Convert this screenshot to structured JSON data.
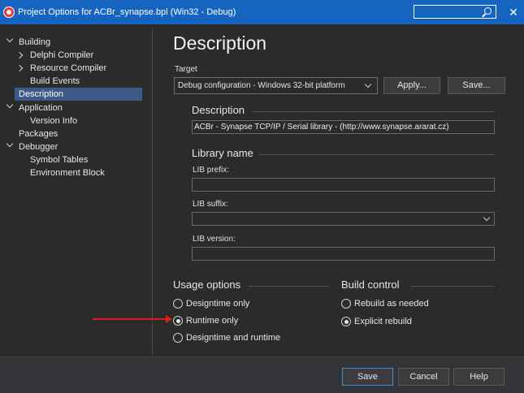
{
  "window": {
    "title": "Project Options for ACBr_synapse.bpl  (Win32 - Debug)",
    "close": "✕"
  },
  "tree": [
    {
      "label": "Building"
    },
    {
      "label": "Delphi Compiler"
    },
    {
      "label": "Resource Compiler"
    },
    {
      "label": "Build Events"
    },
    {
      "label": "Description"
    },
    {
      "label": "Application"
    },
    {
      "label": "Version Info"
    },
    {
      "label": "Packages"
    },
    {
      "label": "Debugger"
    },
    {
      "label": "Symbol Tables"
    },
    {
      "label": "Environment Block"
    }
  ],
  "main": {
    "title": "Description",
    "target_label": "Target",
    "target_value": "Debug configuration - Windows 32-bit platform",
    "apply_label": "Apply...",
    "save_dots_label": "Save...",
    "description_group": "Description",
    "description_value": "ACBr - Synapse TCP/IP / Serial library - (http://www.synapse.ararat.cz)",
    "library_group": "Library name",
    "lib_prefix_label": "LIB prefix:",
    "lib_prefix_value": "",
    "lib_suffix_label": "LIB suffix:",
    "lib_suffix_value": "",
    "lib_version_label": "LIB version:",
    "lib_version_value": "",
    "usage_group": "Usage options",
    "usage_options": [
      "Designtime only",
      "Runtime only",
      "Designtime and runtime"
    ],
    "usage_selected": "Runtime only",
    "build_group": "Build control",
    "build_options": [
      "Rebuild as needed",
      "Explicit rebuild"
    ],
    "build_selected": "Explicit rebuild"
  },
  "footer": {
    "save_label": "Save",
    "cancel_label": "Cancel",
    "help_label": "Help"
  },
  "colors": {
    "titlebar": "#1565c0",
    "background": "#2b2b2b",
    "selection": "#3b5a86",
    "arrow": "#e11c1c"
  },
  "icons": {
    "app": "delphi-app-icon",
    "search": "search-icon",
    "close": "close-icon"
  }
}
